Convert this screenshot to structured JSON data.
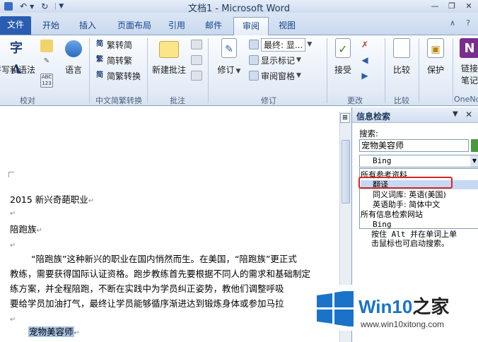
{
  "titlebar": {
    "title": "文档1 - Microsoft Word",
    "icons": [
      "save-icon",
      "undo-icon",
      "redo-icon",
      "customize-qat-icon"
    ],
    "window_buttons": [
      "minimize",
      "restore",
      "close"
    ]
  },
  "tabs": {
    "file": "文件",
    "home": "开始",
    "insert": "插入",
    "layout": "页面布局",
    "references": "引用",
    "mailings": "邮件",
    "review": "审阅",
    "view": "视图"
  },
  "ribbon": {
    "proofing": {
      "label": "校对",
      "spelling": "拼写和语法",
      "language": "语言"
    },
    "chinese": {
      "label": "中文简繁转换",
      "to_simplified": "繁转简",
      "to_traditional": "简转繁",
      "convert": "简繁转换"
    },
    "comments": {
      "label": "批注",
      "new_comment": "新建批注"
    },
    "tracking": {
      "label": "修订",
      "track_changes": "修订",
      "display": "最终: 显...",
      "show_markup": "显示标记",
      "reviewing_pane": "审阅窗格"
    },
    "changes": {
      "label": "更改",
      "accept": "接受"
    },
    "compare": {
      "label": "比较",
      "compare": "比较"
    },
    "protect": {
      "protect": "保护"
    },
    "onenote": {
      "label": "OneNo",
      "linked_notes_1": "链接",
      "linked_notes_2": "笔记"
    }
  },
  "document": {
    "line1": "2015 新兴奇葩职业",
    "line3": "陪跑族",
    "body": [
      "“陪跑族”这种新兴的职业在国内悄然而生。在美国，“陪跑族”更正式",
      "教练，需要获得国际认证资格。跑步教练首先要根据不同人的需求和基础制定",
      "练方案，并全程陪跑，不断在实践中为学员纠正姿势，教他们调整呼吸",
      "要给学员加油打气，最终让学员能够循序渐进达到锻炼身体或参加马拉"
    ],
    "selected": "宠物美容师",
    "para_mark": "↵"
  },
  "research_pane": {
    "title": "信息检索",
    "search_label": "搜索:",
    "search_value": "宠物美容师",
    "source": "Bing",
    "list": {
      "all_reference": "所有参考资料",
      "translate": "翻译",
      "thesaurus": "同义词库: 英语(美国)",
      "english_assistant": "英语助手: 简体中文",
      "all_research_sites": "所有信息检索网站",
      "bing": "Bing"
    },
    "hint_line1": "按住 Alt 并在单词上单",
    "hint_line2": "击鼠标也可启动搜索。"
  },
  "watermark": {
    "title_prefix": "Win10",
    "title_suffix": "之家",
    "url": "www.win10xitong.com"
  },
  "colors": {
    "file_tab": "#2a5db0",
    "highlight_box": "#d62525",
    "selection": "#a9c3e6",
    "watermark_blue": "#1a73c8"
  }
}
